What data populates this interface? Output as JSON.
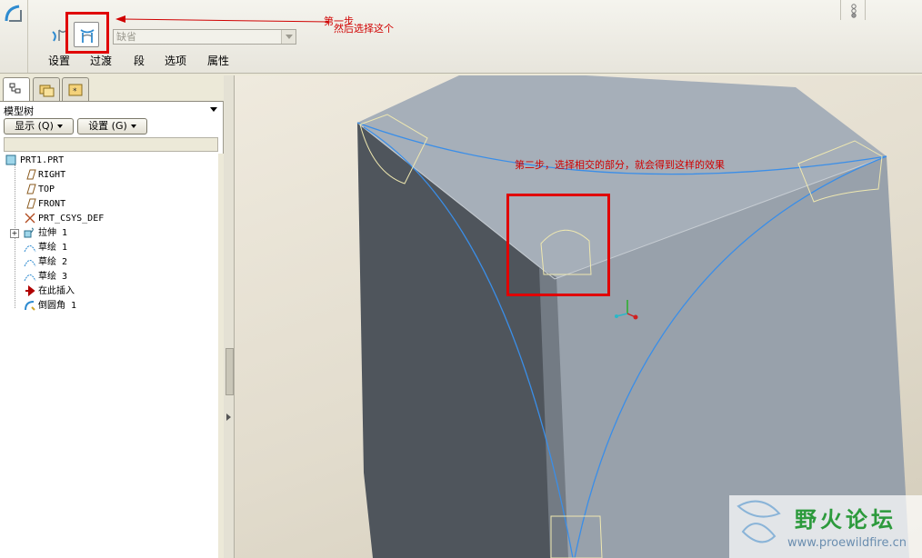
{
  "toolbar": {
    "select_value": "缺省",
    "tabs": [
      "设置",
      "过渡",
      "段",
      "选项",
      "属性"
    ]
  },
  "annotations": {
    "step1_line1": "第一步",
    "step1_line2": "然后选择这个",
    "step2": "第二步，选择相交的部分，就会得到这样的效果"
  },
  "model_tree": {
    "title": "模型树",
    "show_button": "显示 (Q)",
    "settings_button": "设置 (G)",
    "items": [
      {
        "label": "PRT1.PRT",
        "icon": "part-icon"
      },
      {
        "label": "RIGHT",
        "icon": "datum-plane-icon"
      },
      {
        "label": "TOP",
        "icon": "datum-plane-icon"
      },
      {
        "label": "FRONT",
        "icon": "datum-plane-icon"
      },
      {
        "label": "PRT_CSYS_DEF",
        "icon": "csys-icon"
      },
      {
        "label": "拉伸 1",
        "icon": "extrude-icon"
      },
      {
        "label": "草绘 1",
        "icon": "sketch-icon"
      },
      {
        "label": "草绘 2",
        "icon": "sketch-icon"
      },
      {
        "label": "草绘 3",
        "icon": "sketch-icon"
      },
      {
        "label": "在此插入",
        "icon": "insert-here-arrow-icon"
      },
      {
        "label": "倒圆角 1",
        "icon": "round-icon"
      }
    ]
  },
  "watermark": {
    "title": "野火论坛",
    "url": "www.proewildfire.cn"
  },
  "colors": {
    "annotation": "#d00000",
    "highlight": "#e00000",
    "cube_top": "#a7b0ba",
    "cube_right": "#9aa3ad",
    "cube_left": "#4f555c",
    "edge_curve": "#3a8ee8"
  }
}
